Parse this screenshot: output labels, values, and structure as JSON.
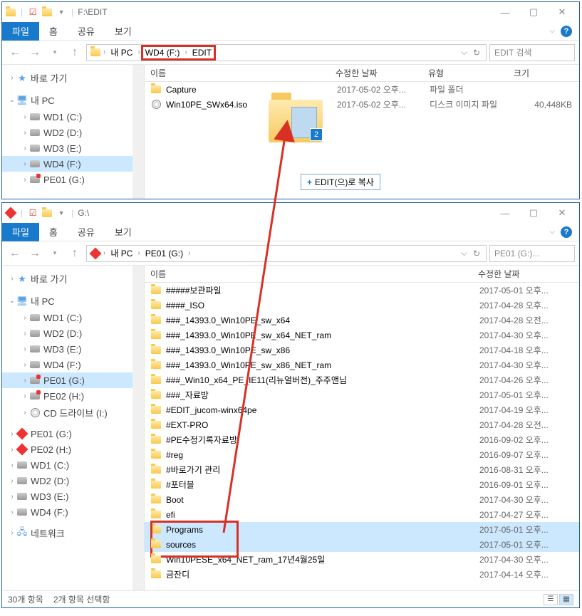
{
  "window1": {
    "title_path": "F:\\EDIT",
    "tabs": {
      "file": "파일",
      "home": "홈",
      "share": "공유",
      "view": "보기"
    },
    "address": {
      "root": "내 PC",
      "seg1": "WD4 (F:)",
      "seg2": "EDIT"
    },
    "search_placeholder": "EDIT 검색",
    "sidebar": {
      "quick": "바로 가기",
      "pc": "내 PC",
      "drives": [
        "WD1 (C:)",
        "WD2 (D:)",
        "WD3 (E:)",
        "WD4 (F:)",
        "PE01 (G:)"
      ]
    },
    "columns": {
      "name": "이름",
      "date": "수정한 날짜",
      "type": "유형",
      "size": "크기"
    },
    "rows": [
      {
        "icon": "folder",
        "name": "Capture",
        "date": "2017-05-02 오후...",
        "type": "파일 폴더",
        "size": ""
      },
      {
        "icon": "iso",
        "name": "Win10PE_SWx64.iso",
        "date": "2017-05-02 오후...",
        "type": "디스크 이미지 파일",
        "size": "40,448KB"
      }
    ],
    "ghost_badge": "2",
    "drop_hint": "EDIT(으)로 복사"
  },
  "window2": {
    "title_path": "G:\\",
    "tabs": {
      "file": "파일",
      "home": "홈",
      "share": "공유",
      "view": "보기"
    },
    "address": {
      "root": "내 PC",
      "seg1": "PE01 (G:)"
    },
    "search_placeholder": "PE01 (G:)...",
    "sidebar": {
      "quick": "바로 가기",
      "pc": "내 PC",
      "drives_main": [
        "WD1 (C:)",
        "WD2 (D:)",
        "WD3 (E:)",
        "WD4 (F:)",
        "PE01 (G:)",
        "PE02 (H:)",
        "CD 드라이브 (I:)"
      ],
      "drives_removable": [
        "PE01 (G:)",
        "PE02 (H:)",
        "WD1 (C:)",
        "WD2 (D:)",
        "WD3 (E:)",
        "WD4 (F:)"
      ],
      "network": "네트워크"
    },
    "columns": {
      "name": "이름",
      "date": "수정한 날짜"
    },
    "rows": [
      {
        "name": "#####보관파일",
        "date": "2017-05-01 오후..."
      },
      {
        "name": "####_ISO",
        "date": "2017-04-28 오후..."
      },
      {
        "name": "###_14393.0_Win10PE_sw_x64",
        "date": "2017-04-28 오전..."
      },
      {
        "name": "###_14393.0_Win10PE_sw_x64_NET_ram",
        "date": "2017-04-30 오후..."
      },
      {
        "name": "###_14393.0_Win10PE_sw_x86",
        "date": "2017-04-18 오후..."
      },
      {
        "name": "###_14393.0_Win10PE_sw_x86_NET_ram",
        "date": "2017-04-30 오후..."
      },
      {
        "name": "###_Win10_x64_PE_IE11(리뉴얼버전)_주주앤님",
        "date": "2017-04-26 오후..."
      },
      {
        "name": "###_자료방",
        "date": "2017-05-01 오후..."
      },
      {
        "name": "#EDIT_jucom-winx64pe",
        "date": "2017-04-19 오후..."
      },
      {
        "name": "#EXT-PRO",
        "date": "2017-04-28 오전..."
      },
      {
        "name": "#PE수정기록자료방",
        "date": "2016-09-02 오후..."
      },
      {
        "name": "#reg",
        "date": "2016-09-07 오후..."
      },
      {
        "name": "#바로가기 관리",
        "date": "2016-08-31 오후..."
      },
      {
        "name": "#포터블",
        "date": "2016-09-01 오후..."
      },
      {
        "name": "Boot",
        "date": "2017-04-30 오후..."
      },
      {
        "name": "efi",
        "date": "2017-04-27 오후..."
      },
      {
        "name": "Programs",
        "date": "2017-05-01 오후...",
        "selected": true,
        "highlightStart": true
      },
      {
        "name": "sources",
        "date": "2017-05-01 오후...",
        "selected": true
      },
      {
        "name": "Win10PESE_x64_NET_ram_17년4월25일",
        "date": "2017-04-30 오후..."
      },
      {
        "name": "금잔디",
        "date": "2017-04-14 오후..."
      }
    ],
    "status": {
      "count": "30개 항목",
      "selected": "2개 항목 선택함"
    }
  }
}
